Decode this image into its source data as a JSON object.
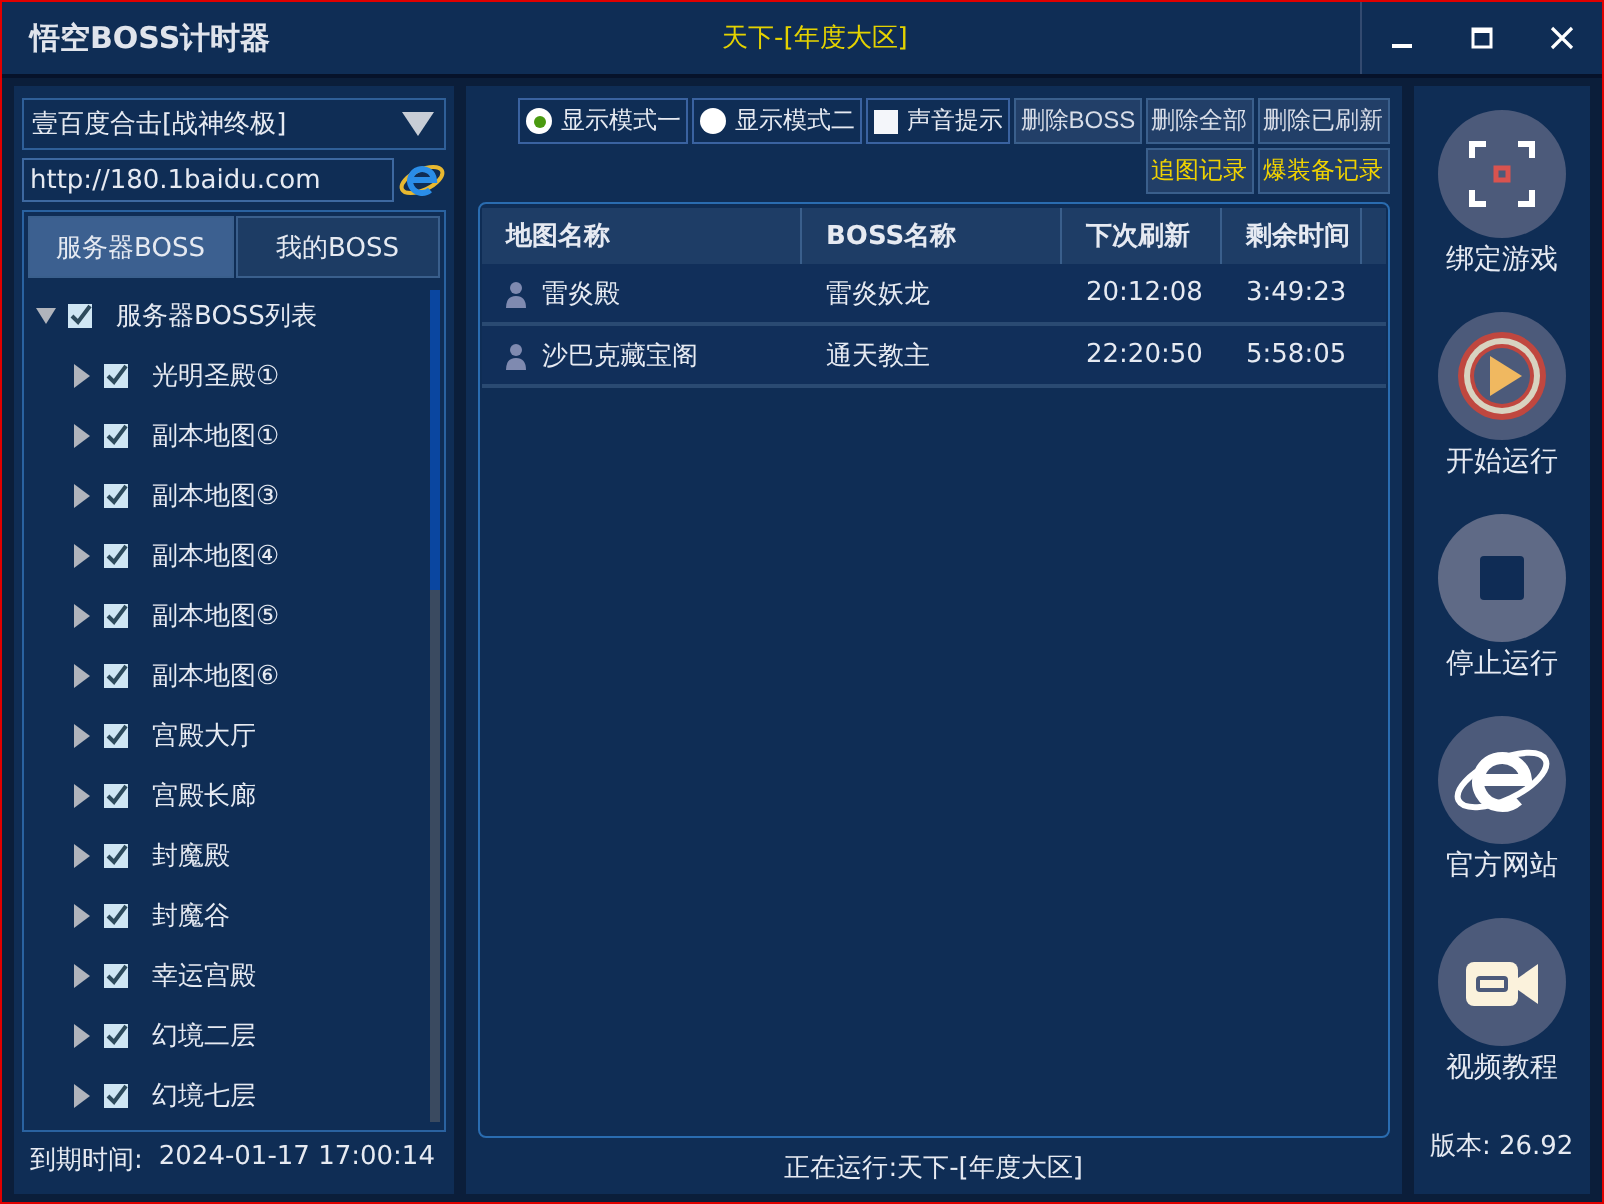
{
  "window": {
    "title": "悟空BOSS计时器",
    "subtitle": "天下-[年度大区]",
    "controls": [
      {
        "kind": "minimize"
      },
      {
        "kind": "maximize"
      },
      {
        "kind": "close"
      }
    ]
  },
  "left": {
    "server_select": "壹百度合击[战神终极]",
    "url": "http://180.1baidu.com",
    "tabs": [
      {
        "label": "服务器BOSS",
        "selected": true
      },
      {
        "label": "我的BOSS",
        "selected": false
      }
    ],
    "tree": [
      {
        "label": "服务器BOSS列表",
        "checked": true,
        "expanded": true,
        "children": [
          {
            "label": "光明圣殿①",
            "checked": true,
            "expanded": false
          },
          {
            "label": "副本地图①",
            "checked": true,
            "expanded": false
          },
          {
            "label": "副本地图③",
            "checked": true,
            "expanded": false
          },
          {
            "label": "副本地图④",
            "checked": true,
            "expanded": false
          },
          {
            "label": "副本地图⑤",
            "checked": true,
            "expanded": false
          },
          {
            "label": "副本地图⑥",
            "checked": true,
            "expanded": false
          },
          {
            "label": "宫殿大厅",
            "checked": true,
            "expanded": false
          },
          {
            "label": "宫殿长廊",
            "checked": true,
            "expanded": false
          },
          {
            "label": "封魔殿",
            "checked": true,
            "expanded": false
          },
          {
            "label": "封魔谷",
            "checked": true,
            "expanded": false
          },
          {
            "label": "幸运宫殿",
            "checked": true,
            "expanded": false
          },
          {
            "label": "幻境二层",
            "checked": true,
            "expanded": false
          },
          {
            "label": "幻境七层",
            "checked": true,
            "expanded": false
          }
        ]
      }
    ],
    "expiry_label": "到期时间:",
    "expiry_value": "2024-01-17 17:00:14"
  },
  "toolbar": {
    "modes": [
      {
        "label": "显示模式一",
        "selected": true
      },
      {
        "label": "显示模式二",
        "selected": false
      }
    ],
    "sound": {
      "label": "声音提示",
      "checked": false
    },
    "buttons": [
      {
        "label": "删除BOSS",
        "kind": "normal"
      },
      {
        "label": "删除全部",
        "kind": "normal"
      },
      {
        "label": "删除已刷新",
        "kind": "normal"
      },
      {
        "label": "追图记录",
        "kind": "highlight"
      },
      {
        "label": "爆装备记录",
        "kind": "highlight"
      }
    ]
  },
  "table": {
    "columns": [
      "地图名称",
      "BOSS名称",
      "下次刷新",
      "剩余时间"
    ],
    "rows": [
      [
        "雷炎殿",
        "雷炎妖龙",
        "20:12:08",
        "3:49:23"
      ],
      [
        "沙巴克藏宝阁",
        "通天教主",
        "22:20:50",
        "5:58:05"
      ]
    ]
  },
  "status_bar": "正在运行:天下-[年度大区]",
  "sidebar": {
    "items": [
      {
        "label": "绑定游戏",
        "kind": "bind"
      },
      {
        "label": "开始运行",
        "kind": "start"
      },
      {
        "label": "停止运行",
        "kind": "stop"
      },
      {
        "label": "官方网站",
        "kind": "web"
      },
      {
        "label": "视频教程",
        "kind": "video"
      }
    ],
    "version": "版本: 26.92"
  }
}
